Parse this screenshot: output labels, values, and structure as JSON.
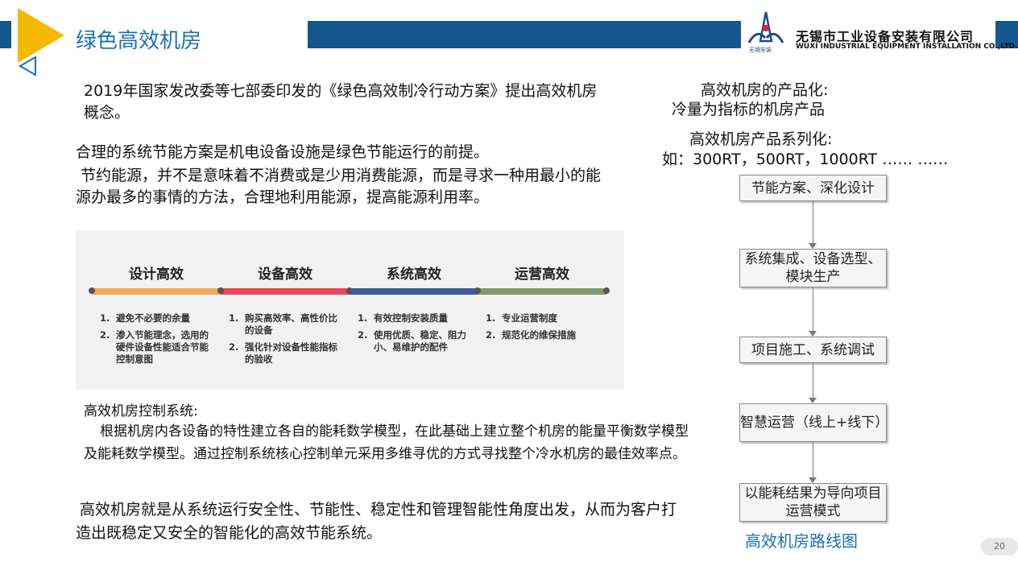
{
  "header": {
    "title": "绿色高效机房",
    "company_cn": "无锡市工业设备安装有限公司",
    "company_en": "WUXI INDUSTRIAL EQUIPMENT INSTALLATION CO.,LTD.",
    "logo_sub": "无锡安装",
    "accent_color": "#f5b800",
    "bar_color": "#16568f"
  },
  "left": {
    "intro": "2019年国家发改委等七部委印发的《绿色高效制冷行动方案》提出高效机房概念。",
    "para1_line1": "合理的系统节能方案是机电设备设施是绿色节能运行的前提。",
    "para1_line2": " 节约能源，并不是意味着不消费或是少用消费能源，而是寻求一种用最小的能源办最多的事情的方法，合理地利用能源，提高能源利用率。",
    "control_title": "高效机房控制系统:",
    "control_body": "根据机房内各设备的特性建立各自的能耗数学模型，在此基础上建立整个机房的能量平衡数学模型及能耗数学模型。通过控制系统核心控制单元采用多维寻优的方式寻找整个冷水机房的最佳效率点。",
    "conclusion": "高效机房就是从系统运行安全性、节能性、稳定性和管理智能性角度出发，从而为客户打造出既稳定又安全的智能化的高效节能系统。"
  },
  "stages": [
    {
      "title": "设计高效",
      "color": "#f0a95a",
      "items": [
        {
          "num": "1.",
          "text": "避免不必要的余量"
        },
        {
          "num": "2.",
          "text": "渗入节能理念，选用的硬件设备性能适合节能控制意图"
        }
      ]
    },
    {
      "title": "设备高效",
      "color": "#e8485a",
      "items": [
        {
          "num": "1.",
          "text": "购买高效率、高性价比的设备"
        },
        {
          "num": "2.",
          "text": "强化针对设备性能指标的验收"
        }
      ]
    },
    {
      "title": "系统高效",
      "color": "#3c5f96",
      "items": [
        {
          "num": "1.",
          "text": "有效控制安装质量"
        },
        {
          "num": "2.",
          "text": "使用优质、稳定、阻力小、易维护的配件"
        }
      ]
    },
    {
      "title": "运营高效",
      "color": "#7e9a6a",
      "items": [
        {
          "num": "1.",
          "text": "专业运营制度"
        },
        {
          "num": "2.",
          "text": "规范化的维保措施"
        }
      ]
    }
  ],
  "right": {
    "product_line1": "高效机房的产品化:",
    "product_line2": "冷量为指标的机房产品",
    "series_line1": "高效机房产品系列化:",
    "series_line2": "如：300RT，500RT，1000RT …… ……",
    "flow": [
      "节能方案、深化设计",
      "系统集成、设备选型、模块生产",
      "项目施工、系统调试",
      "智慧运营（线上+线下）",
      "以能耗结果为导向项目运营模式"
    ],
    "flow_caption": "高效机房路线图"
  },
  "page_number": "20"
}
